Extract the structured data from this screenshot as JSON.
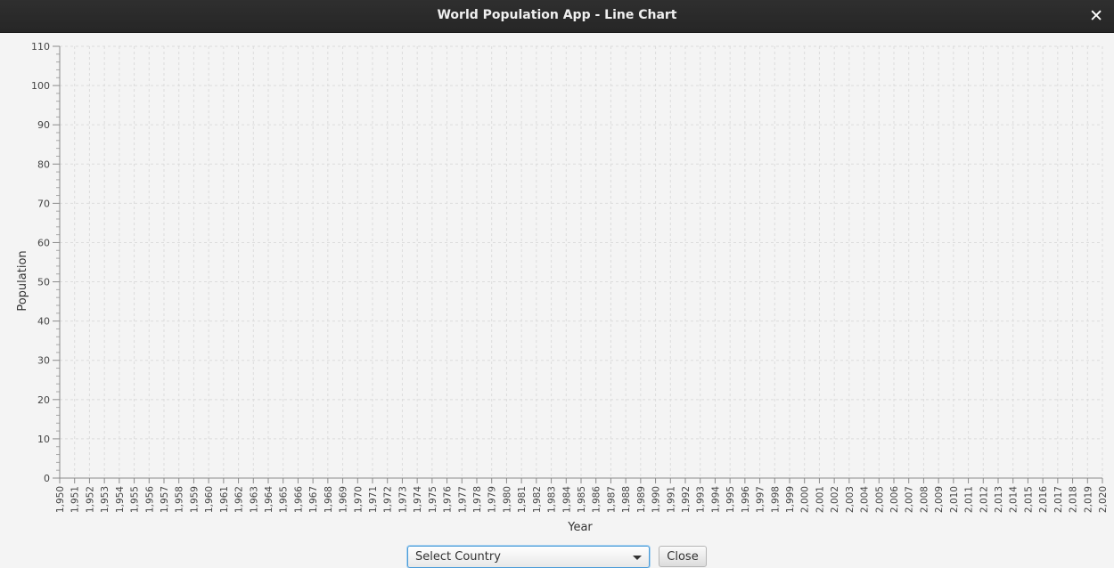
{
  "window": {
    "title": "World Population App - Line Chart",
    "close_glyph": "✕"
  },
  "chart_data": {
    "type": "line",
    "xlabel": "Year",
    "ylabel": "Population",
    "x_ticks": [
      "1,950",
      "1,951",
      "1,952",
      "1,953",
      "1,954",
      "1,955",
      "1,956",
      "1,957",
      "1,958",
      "1,959",
      "1,960",
      "1,961",
      "1,962",
      "1,963",
      "1,964",
      "1,965",
      "1,966",
      "1,967",
      "1,968",
      "1,969",
      "1,970",
      "1,971",
      "1,972",
      "1,973",
      "1,974",
      "1,975",
      "1,976",
      "1,977",
      "1,978",
      "1,979",
      "1,980",
      "1,981",
      "1,982",
      "1,983",
      "1,984",
      "1,985",
      "1,986",
      "1,987",
      "1,988",
      "1,989",
      "1,990",
      "1,991",
      "1,992",
      "1,993",
      "1,994",
      "1,995",
      "1,996",
      "1,997",
      "1,998",
      "1,999",
      "2,000",
      "2,001",
      "2,002",
      "2,003",
      "2,004",
      "2,005",
      "2,006",
      "2,007",
      "2,008",
      "2,009",
      "2,010",
      "2,011",
      "2,012",
      "2,013",
      "2,014",
      "2,015",
      "2,016",
      "2,017",
      "2,018",
      "2,019",
      "2,020"
    ],
    "y_ticks": [
      "0",
      "10",
      "20",
      "30",
      "40",
      "50",
      "60",
      "70",
      "80",
      "90",
      "100",
      "110"
    ],
    "xlim": [
      1950,
      2020
    ],
    "ylim": [
      0,
      110
    ],
    "grid": true,
    "series": []
  },
  "controls": {
    "country_select_label": "Select Country",
    "close_label": "Close"
  }
}
